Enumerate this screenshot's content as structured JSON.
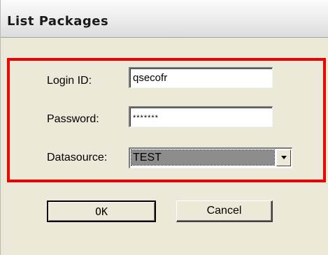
{
  "dialog": {
    "title": "List Packages"
  },
  "form": {
    "login_label": "Login ID:",
    "login_value": "qsecofr",
    "password_label": "Password:",
    "password_value": "*******",
    "datasource_label": "Datasource:",
    "datasource_value": "TEST"
  },
  "buttons": {
    "ok_label": "OK",
    "cancel_label": "Cancel"
  },
  "colors": {
    "highlight_border": "#ee0000",
    "dialog_background": "#ece9d8"
  },
  "icons": {
    "dropdown": "chevron-down-icon"
  }
}
